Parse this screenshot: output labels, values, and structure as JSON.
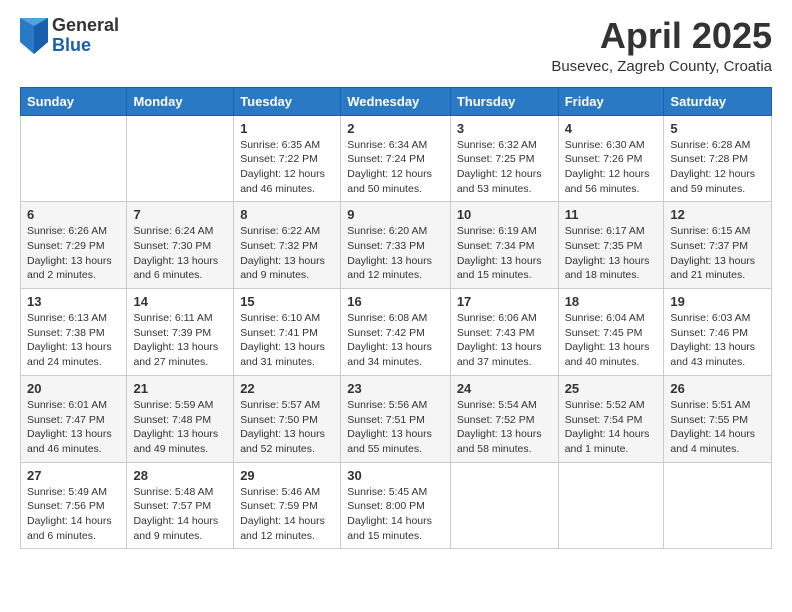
{
  "logo": {
    "general": "General",
    "blue": "Blue"
  },
  "title": "April 2025",
  "location": "Busevec, Zagreb County, Croatia",
  "weekdays": [
    "Sunday",
    "Monday",
    "Tuesday",
    "Wednesday",
    "Thursday",
    "Friday",
    "Saturday"
  ],
  "weeks": [
    [
      {
        "day": "",
        "info": ""
      },
      {
        "day": "",
        "info": ""
      },
      {
        "day": "1",
        "info": "Sunrise: 6:35 AM\nSunset: 7:22 PM\nDaylight: 12 hours\nand 46 minutes."
      },
      {
        "day": "2",
        "info": "Sunrise: 6:34 AM\nSunset: 7:24 PM\nDaylight: 12 hours\nand 50 minutes."
      },
      {
        "day": "3",
        "info": "Sunrise: 6:32 AM\nSunset: 7:25 PM\nDaylight: 12 hours\nand 53 minutes."
      },
      {
        "day": "4",
        "info": "Sunrise: 6:30 AM\nSunset: 7:26 PM\nDaylight: 12 hours\nand 56 minutes."
      },
      {
        "day": "5",
        "info": "Sunrise: 6:28 AM\nSunset: 7:28 PM\nDaylight: 12 hours\nand 59 minutes."
      }
    ],
    [
      {
        "day": "6",
        "info": "Sunrise: 6:26 AM\nSunset: 7:29 PM\nDaylight: 13 hours\nand 2 minutes."
      },
      {
        "day": "7",
        "info": "Sunrise: 6:24 AM\nSunset: 7:30 PM\nDaylight: 13 hours\nand 6 minutes."
      },
      {
        "day": "8",
        "info": "Sunrise: 6:22 AM\nSunset: 7:32 PM\nDaylight: 13 hours\nand 9 minutes."
      },
      {
        "day": "9",
        "info": "Sunrise: 6:20 AM\nSunset: 7:33 PM\nDaylight: 13 hours\nand 12 minutes."
      },
      {
        "day": "10",
        "info": "Sunrise: 6:19 AM\nSunset: 7:34 PM\nDaylight: 13 hours\nand 15 minutes."
      },
      {
        "day": "11",
        "info": "Sunrise: 6:17 AM\nSunset: 7:35 PM\nDaylight: 13 hours\nand 18 minutes."
      },
      {
        "day": "12",
        "info": "Sunrise: 6:15 AM\nSunset: 7:37 PM\nDaylight: 13 hours\nand 21 minutes."
      }
    ],
    [
      {
        "day": "13",
        "info": "Sunrise: 6:13 AM\nSunset: 7:38 PM\nDaylight: 13 hours\nand 24 minutes."
      },
      {
        "day": "14",
        "info": "Sunrise: 6:11 AM\nSunset: 7:39 PM\nDaylight: 13 hours\nand 27 minutes."
      },
      {
        "day": "15",
        "info": "Sunrise: 6:10 AM\nSunset: 7:41 PM\nDaylight: 13 hours\nand 31 minutes."
      },
      {
        "day": "16",
        "info": "Sunrise: 6:08 AM\nSunset: 7:42 PM\nDaylight: 13 hours\nand 34 minutes."
      },
      {
        "day": "17",
        "info": "Sunrise: 6:06 AM\nSunset: 7:43 PM\nDaylight: 13 hours\nand 37 minutes."
      },
      {
        "day": "18",
        "info": "Sunrise: 6:04 AM\nSunset: 7:45 PM\nDaylight: 13 hours\nand 40 minutes."
      },
      {
        "day": "19",
        "info": "Sunrise: 6:03 AM\nSunset: 7:46 PM\nDaylight: 13 hours\nand 43 minutes."
      }
    ],
    [
      {
        "day": "20",
        "info": "Sunrise: 6:01 AM\nSunset: 7:47 PM\nDaylight: 13 hours\nand 46 minutes."
      },
      {
        "day": "21",
        "info": "Sunrise: 5:59 AM\nSunset: 7:48 PM\nDaylight: 13 hours\nand 49 minutes."
      },
      {
        "day": "22",
        "info": "Sunrise: 5:57 AM\nSunset: 7:50 PM\nDaylight: 13 hours\nand 52 minutes."
      },
      {
        "day": "23",
        "info": "Sunrise: 5:56 AM\nSunset: 7:51 PM\nDaylight: 13 hours\nand 55 minutes."
      },
      {
        "day": "24",
        "info": "Sunrise: 5:54 AM\nSunset: 7:52 PM\nDaylight: 13 hours\nand 58 minutes."
      },
      {
        "day": "25",
        "info": "Sunrise: 5:52 AM\nSunset: 7:54 PM\nDaylight: 14 hours\nand 1 minute."
      },
      {
        "day": "26",
        "info": "Sunrise: 5:51 AM\nSunset: 7:55 PM\nDaylight: 14 hours\nand 4 minutes."
      }
    ],
    [
      {
        "day": "27",
        "info": "Sunrise: 5:49 AM\nSunset: 7:56 PM\nDaylight: 14 hours\nand 6 minutes."
      },
      {
        "day": "28",
        "info": "Sunrise: 5:48 AM\nSunset: 7:57 PM\nDaylight: 14 hours\nand 9 minutes."
      },
      {
        "day": "29",
        "info": "Sunrise: 5:46 AM\nSunset: 7:59 PM\nDaylight: 14 hours\nand 12 minutes."
      },
      {
        "day": "30",
        "info": "Sunrise: 5:45 AM\nSunset: 8:00 PM\nDaylight: 14 hours\nand 15 minutes."
      },
      {
        "day": "",
        "info": ""
      },
      {
        "day": "",
        "info": ""
      },
      {
        "day": "",
        "info": ""
      }
    ]
  ]
}
